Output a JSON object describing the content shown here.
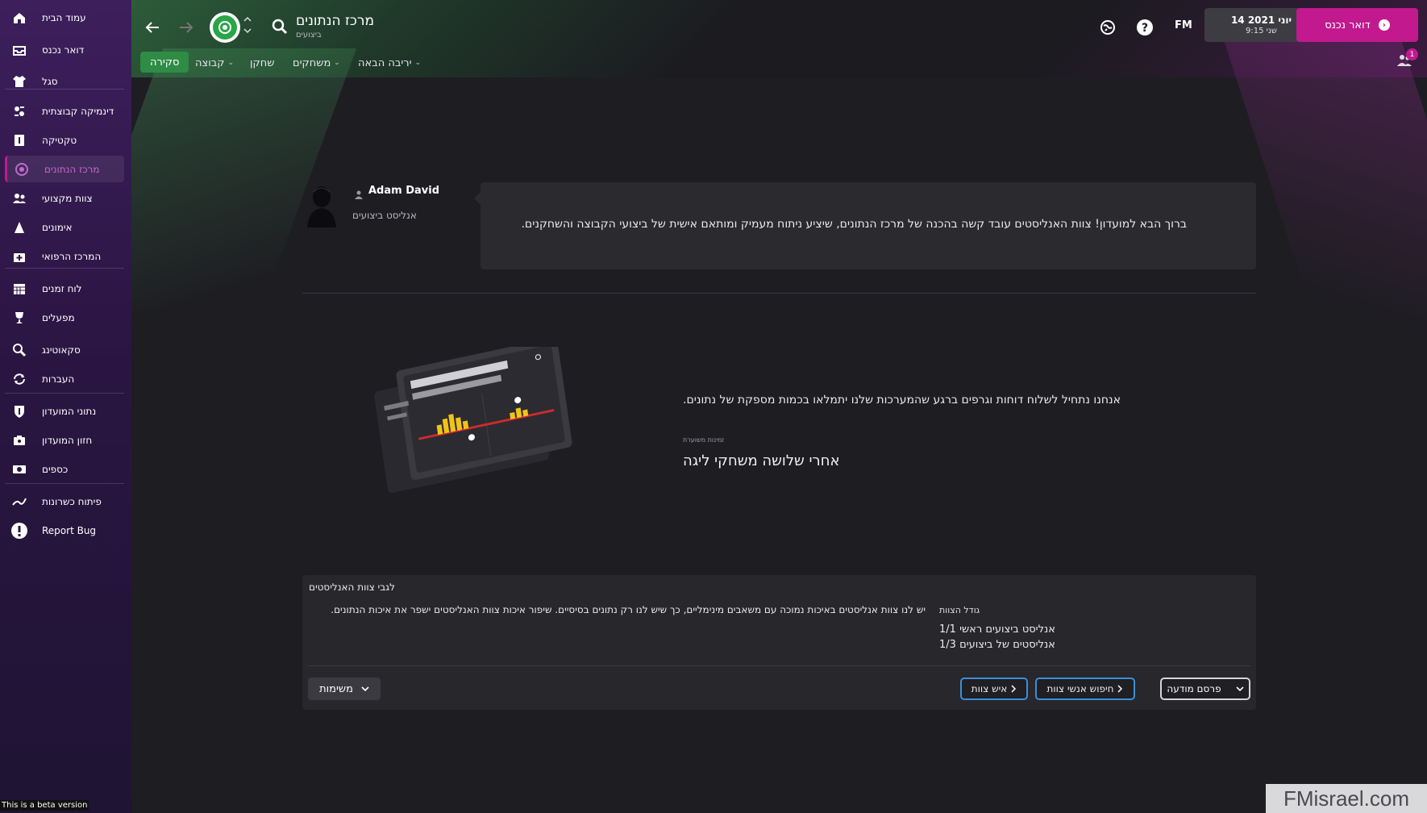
{
  "sidebar": {
    "items": [
      {
        "label": "עמוד הבית",
        "icon": "home-icon"
      },
      {
        "label": "דואר נכנס",
        "icon": "inbox-icon"
      },
      {
        "label": "סגל",
        "icon": "shirt-icon"
      },
      {
        "label": "דינמיקה קבוצתית",
        "icon": "dynamics-icon"
      },
      {
        "label": "טקטיקה",
        "icon": "tactics-icon"
      },
      {
        "label": "מרכז הנתונים",
        "icon": "data-hub-icon"
      },
      {
        "label": "צוות מקצועי",
        "icon": "staff-icon"
      },
      {
        "label": "אימונים",
        "icon": "training-icon"
      },
      {
        "label": "המרכז הרפואי",
        "icon": "medical-icon"
      },
      {
        "label": "לוח זמנים",
        "icon": "calendar-icon"
      },
      {
        "label": "מפעלים",
        "icon": "trophy-icon"
      },
      {
        "label": "סקאוטינג",
        "icon": "magnifier-icon"
      },
      {
        "label": "העברות",
        "icon": "transfers-icon"
      },
      {
        "label": "נתוני המועדון",
        "icon": "club-info-icon"
      },
      {
        "label": "חזון המועדון",
        "icon": "club-vision-icon"
      },
      {
        "label": "כספים",
        "icon": "finances-icon"
      },
      {
        "label": "פיתוח כשרונות",
        "icon": "development-icon"
      },
      {
        "label": "Report Bug",
        "icon": "report-bug-icon"
      }
    ],
    "beta_text": "This is a beta version"
  },
  "header": {
    "title": "מרכז הנתונים",
    "subtitle": "ביצועים",
    "date": "14 יוני 2021",
    "time": "9:15 שני",
    "fm_logo": "FM",
    "continue_label": "דואר נכנס",
    "notification_count": "1"
  },
  "subnav": {
    "close": "סקירה",
    "team": "קבוצה",
    "player": "שחקן",
    "matches": "משחקים",
    "next_opponent": "יריבה הבאה"
  },
  "message": {
    "sender": "Adam David",
    "role": "אנליסט ביצועים",
    "text": "ברוך הבא למועדון! צוות האנליסטים עובד קשה בהכנה של מרכז הנתונים, שיציע ניתוח מעמיק ומותאם אישית של ביצועי הקבוצה והשחקנים."
  },
  "intro": {
    "text": "אנחנו נתחיל לשלוח דוחות וגרפים ברגע שהמערכות שלנו יתמלאו בכמות מספקת של נתונים.",
    "timing_label": "זמינות משוערת",
    "timing_value": "אחרי שלושה משחקי ליגה"
  },
  "info": {
    "title": "לגבי צוות האנליסטים",
    "description": "יש לנו צוות אנליסטים באיכות נמוכה עם משאבים מינימליים, כך שיש לנו רק נתונים בסיסיים. שיפור איכות צוות האנליסטים ישפר את איכות הנתונים.",
    "size_heading": "גודל הצוות",
    "size_rows": [
      "1/1 אנליסט ביצועים ראשי",
      "1/3 אנליסטים של ביצועים"
    ],
    "tasks_label": "משימות",
    "staff_member_label": "איש צוות",
    "search_staff_label": "חיפוש אנשי צוות",
    "advertise_label": "פרסם מודעה"
  },
  "watermark": "FMisrael.com",
  "colors": {
    "accent": "#c2198f",
    "close_green": "#2e8c45",
    "sidebar_top": "#3d1f5c",
    "button_outline": "#3c8fd6"
  }
}
